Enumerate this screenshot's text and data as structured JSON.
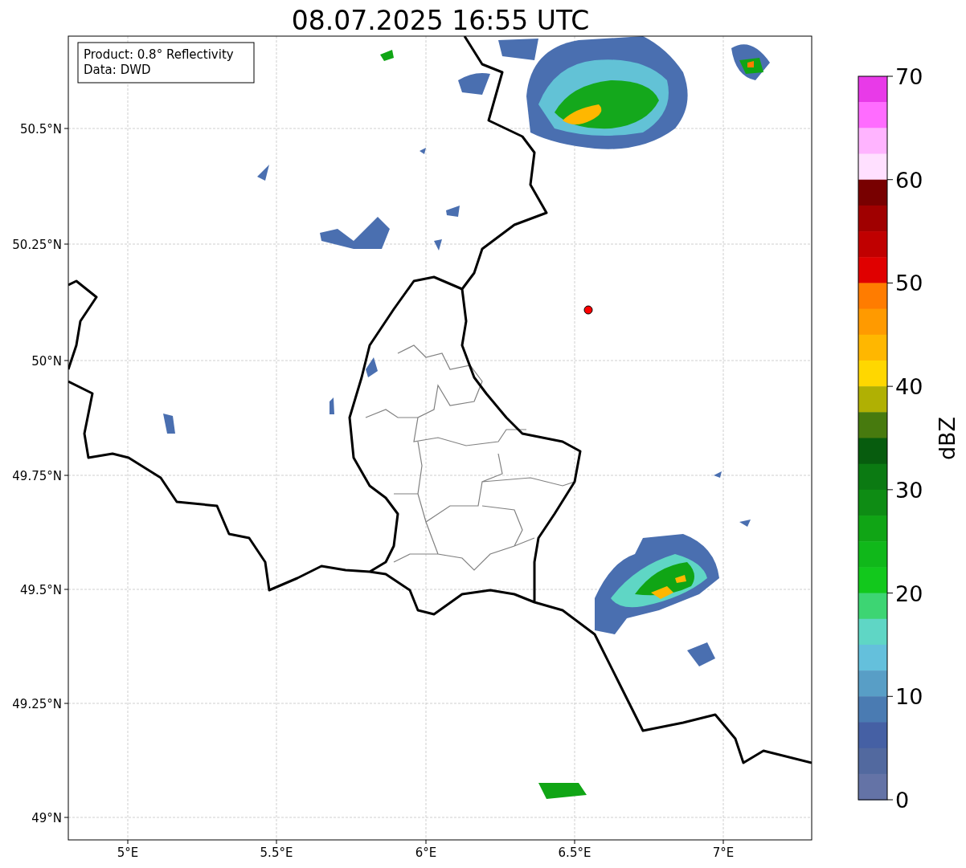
{
  "title": "08.07.2025 16:55 UTC",
  "map": {
    "info_lines": [
      "Product: 0.8° Reflectivity",
      "Data: DWD"
    ],
    "y_ticks": [
      "50.5°N",
      "50.25°N",
      "50°N",
      "49.75°N",
      "49.5°N",
      "49.25°N",
      "49°N"
    ],
    "x_ticks": [
      "5°E",
      "5.5°E",
      "6°E",
      "6.5°E",
      "7°E"
    ]
  },
  "colorbar": {
    "label": "dBZ",
    "ticks": [
      "70",
      "60",
      "50",
      "40",
      "30",
      "20",
      "10",
      "0"
    ],
    "bands": [
      {
        "color": "#e83ae8"
      },
      {
        "color": "#ff6cff"
      },
      {
        "color": "#ffb4ff"
      },
      {
        "color": "#ffe0ff"
      },
      {
        "color": "#780000"
      },
      {
        "color": "#a00000"
      },
      {
        "color": "#c00000"
      },
      {
        "color": "#e00000"
      },
      {
        "color": "#ff7c00"
      },
      {
        "color": "#ff9a00"
      },
      {
        "color": "#ffb700"
      },
      {
        "color": "#ffd700"
      },
      {
        "color": "#b0b003"
      },
      {
        "color": "#477a0e"
      },
      {
        "color": "#075c0e"
      },
      {
        "color": "#0b7a12"
      },
      {
        "color": "#0e8c14"
      },
      {
        "color": "#10a515"
      },
      {
        "color": "#10b81a"
      },
      {
        "color": "#12c81c"
      },
      {
        "color": "#3dd573"
      },
      {
        "color": "#5fd6c5"
      },
      {
        "color": "#64c0dc"
      },
      {
        "color": "#589ec6"
      },
      {
        "color": "#4a7bb2"
      },
      {
        "color": "#4560a4"
      },
      {
        "color": "#52699f"
      },
      {
        "color": "#6473a6"
      }
    ]
  }
}
